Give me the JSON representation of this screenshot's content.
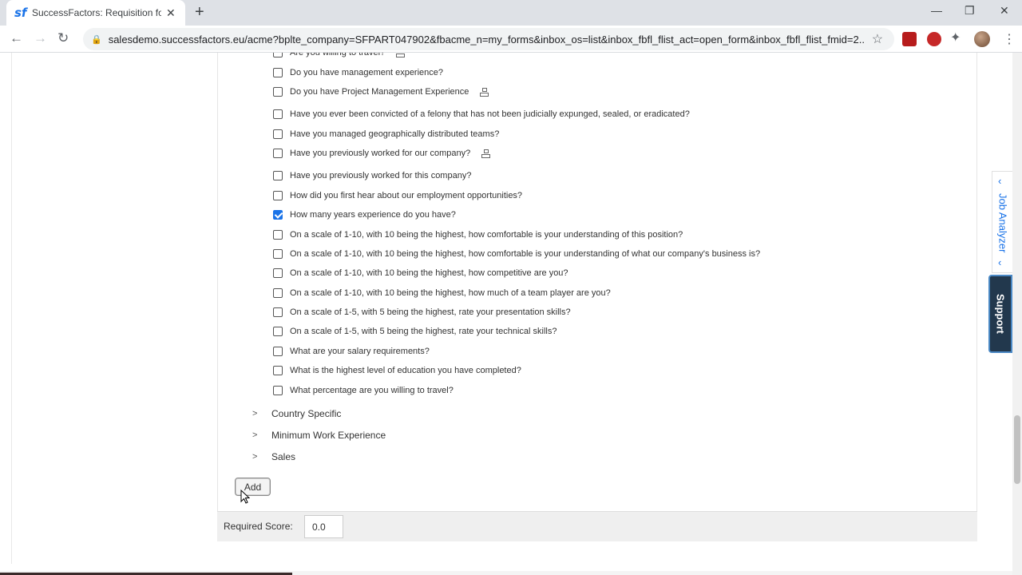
{
  "browser": {
    "tab_title": "SuccessFactors: Requisition for H",
    "favicon": "sf",
    "url": "salesdemo.successfactors.eu/acme?bplte_company=SFPART047902&fbacme_n=my_forms&inbox_os=list&inbox_fbfl_flist_act=open_form&inbox_fbfl_flist_fmid=2..."
  },
  "questions": [
    {
      "label": "Are you willing to travel?",
      "checked": false,
      "hier": true
    },
    {
      "label": "Do you have management experience?",
      "checked": false,
      "hier": false
    },
    {
      "label": "Do you have Project Management Experience",
      "checked": false,
      "hier": true
    },
    {
      "label": "Have you ever been convicted of a felony that has not been judicially expunged, sealed, or eradicated?",
      "checked": false,
      "hier": false
    },
    {
      "label": "Have you managed geographically distributed teams?",
      "checked": false,
      "hier": false
    },
    {
      "label": "Have you previously worked for our company?",
      "checked": false,
      "hier": true
    },
    {
      "label": "Have you previously worked for this company?",
      "checked": false,
      "hier": false
    },
    {
      "label": "How did you first hear about our employment opportunities?",
      "checked": false,
      "hier": false
    },
    {
      "label": "How many years experience do you have?",
      "checked": true,
      "hier": false
    },
    {
      "label": "On a scale of 1-10, with 10 being the highest, how comfortable is your understanding of this position?",
      "checked": false,
      "hier": false
    },
    {
      "label": "On a scale of 1-10, with 10 being the highest, how comfortable is your understanding of what our company's business is?",
      "checked": false,
      "hier": false
    },
    {
      "label": "On a scale of 1-10, with 10 being the highest, how competitive are you?",
      "checked": false,
      "hier": false
    },
    {
      "label": "On a scale of 1-10, with 10 being the highest, how much of a team player are you?",
      "checked": false,
      "hier": false
    },
    {
      "label": "On a scale of 1-5, with 5 being the highest, rate your presentation skills?",
      "checked": false,
      "hier": false
    },
    {
      "label": "On a scale of 1-5, with 5 being the highest, rate your technical skills?",
      "checked": false,
      "hier": false
    },
    {
      "label": "What are your salary requirements?",
      "checked": false,
      "hier": false
    },
    {
      "label": "What is the highest level of education you have completed?",
      "checked": false,
      "hier": false
    },
    {
      "label": "What percentage are you willing to travel?",
      "checked": false,
      "hier": false
    }
  ],
  "categories": [
    "Country Specific",
    "Minimum Work Experience",
    "Sales"
  ],
  "add_button": "Add",
  "score": {
    "label": "Required Score:",
    "value": "0.0"
  },
  "side_tabs": {
    "job_analyzer": "Job Analyzer",
    "support": "Support"
  }
}
